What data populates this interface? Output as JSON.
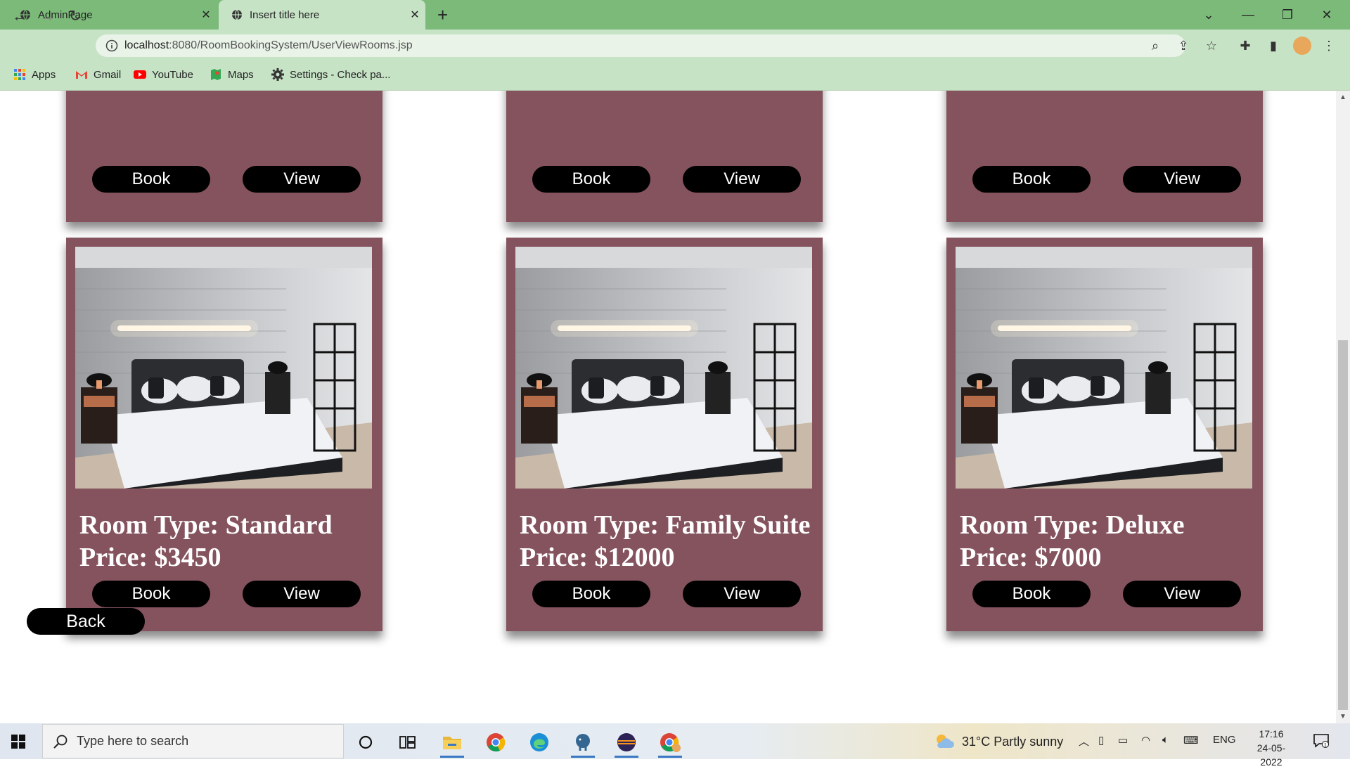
{
  "browser": {
    "tabs": [
      {
        "title": "AdminPage",
        "active": false
      },
      {
        "title": "Insert title here",
        "active": true
      }
    ],
    "url": {
      "host": "localhost",
      "rest": ":8080/RoomBookingSystem/UserViewRooms.jsp"
    },
    "bookmarks": [
      {
        "label": "Apps",
        "icon": "apps-grid-icon"
      },
      {
        "label": "Gmail",
        "icon": "gmail-icon"
      },
      {
        "label": "YouTube",
        "icon": "youtube-icon"
      },
      {
        "label": "Maps",
        "icon": "maps-icon"
      },
      {
        "label": "Settings - Check pa...",
        "icon": "settings-gear-icon"
      }
    ]
  },
  "page": {
    "top_row_buttons": {
      "book": "Book",
      "view": "View"
    },
    "rooms": [
      {
        "type_line": "Room Type: Standard",
        "price_line": "Price: $3450",
        "book_label": "Book",
        "view_label": "View"
      },
      {
        "type_line": "Room Type: Family Suite",
        "price_line": "Price: $12000",
        "book_label": "Book",
        "view_label": "View"
      },
      {
        "type_line": "Room Type: Deluxe",
        "price_line": "Price: $7000",
        "book_label": "Book",
        "view_label": "View"
      }
    ],
    "back_label": "Back",
    "colors": {
      "card": "#84535e",
      "button": "#000000",
      "tab_strip": "#7cba7a",
      "toolbar": "#c7e3c6"
    }
  },
  "taskbar": {
    "search_placeholder": "Type here to search",
    "weather": "31°C  Partly sunny",
    "language": "ENG",
    "time": "17:16",
    "date": "24-05-2022",
    "notification_count": "1"
  }
}
